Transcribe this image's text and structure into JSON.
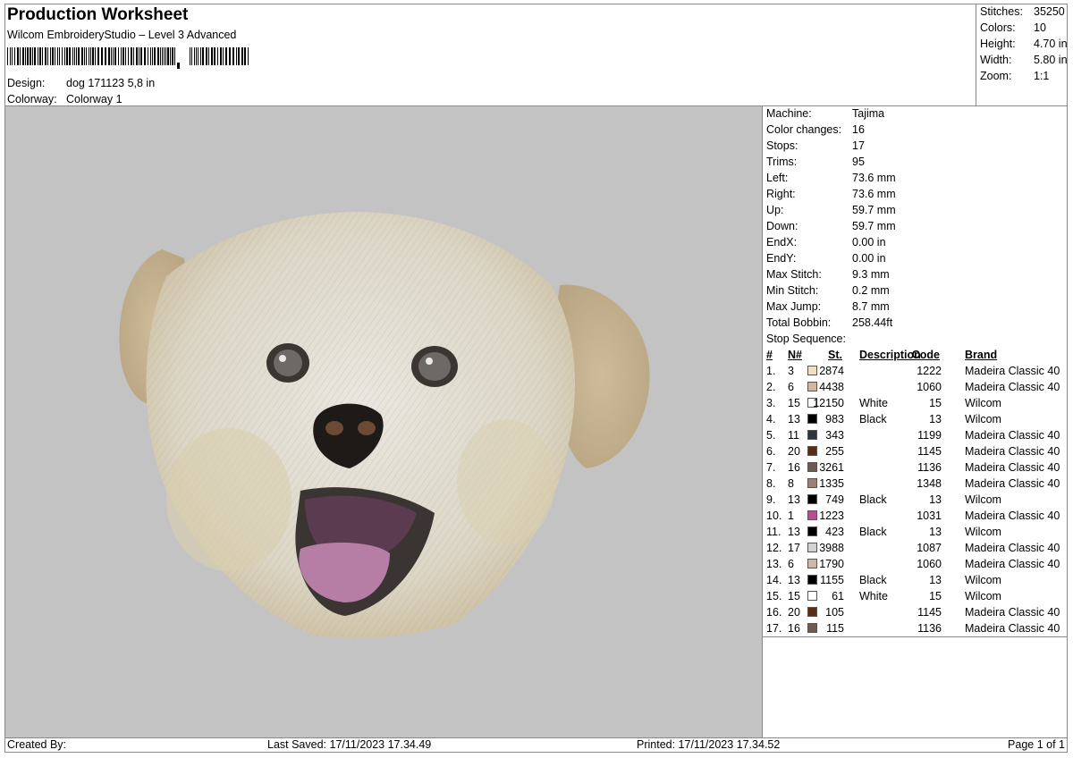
{
  "header": {
    "title": "Production Worksheet",
    "subtitle": "Wilcom EmbroideryStudio – Level 3 Advanced",
    "design_label": "Design:",
    "design_value": "dog 171123 5,8 in",
    "colorway_label": "Colorway:",
    "colorway_value": "Colorway 1"
  },
  "summary": [
    {
      "label": "Stitches:",
      "value": "35250"
    },
    {
      "label": "Colors:",
      "value": "10"
    },
    {
      "label": "Height:",
      "value": "4.70 in"
    },
    {
      "label": "Width:",
      "value": "5.80 in"
    },
    {
      "label": "Zoom:",
      "value": "1:1"
    }
  ],
  "machine_info": [
    {
      "label": "Machine:",
      "value": "Tajima"
    },
    {
      "label": "Color changes:",
      "value": "16"
    },
    {
      "label": "Stops:",
      "value": "17"
    },
    {
      "label": "Trims:",
      "value": "95"
    },
    {
      "label": "Left:",
      "value": "73.6 mm"
    },
    {
      "label": "Right:",
      "value": "73.6 mm"
    },
    {
      "label": "Up:",
      "value": "59.7 mm"
    },
    {
      "label": "Down:",
      "value": "59.7 mm"
    },
    {
      "label": "EndX:",
      "value": "0.00 in"
    },
    {
      "label": "EndY:",
      "value": "0.00 in"
    },
    {
      "label": "Max Stitch:",
      "value": "9.3 mm"
    },
    {
      "label": "Min Stitch:",
      "value": "0.2 mm"
    },
    {
      "label": "Max Jump:",
      "value": "8.7 mm"
    },
    {
      "label": "Total Bobbin:",
      "value": "258.44ft"
    }
  ],
  "stop_sequence": {
    "title": "Stop Sequence:",
    "headers": {
      "num": "#",
      "n": "N#",
      "st": "St.",
      "desc": "Description",
      "code": "Code",
      "brand": "Brand"
    },
    "rows": [
      {
        "num": "1.",
        "n": "3",
        "color": "#efe0c4",
        "st": "2874",
        "desc": "",
        "code": "1222",
        "brand": "Madeira Classic 40"
      },
      {
        "num": "2.",
        "n": "6",
        "color": "#cdb8a6",
        "st": "4438",
        "desc": "",
        "code": "1060",
        "brand": "Madeira Classic 40"
      },
      {
        "num": "3.",
        "n": "15",
        "color": "#ffffff",
        "st": "12150",
        "desc": "White",
        "code": "15",
        "brand": "Wilcom"
      },
      {
        "num": "4.",
        "n": "13",
        "color": "#000000",
        "st": "983",
        "desc": "Black",
        "code": "13",
        "brand": "Wilcom"
      },
      {
        "num": "5.",
        "n": "11",
        "color": "#2e3440",
        "st": "343",
        "desc": "",
        "code": "1199",
        "brand": "Madeira Classic 40"
      },
      {
        "num": "6.",
        "n": "20",
        "color": "#5a2e14",
        "st": "255",
        "desc": "",
        "code": "1145",
        "brand": "Madeira Classic 40"
      },
      {
        "num": "7.",
        "n": "16",
        "color": "#6e5a52",
        "st": "3261",
        "desc": "",
        "code": "1136",
        "brand": "Madeira Classic 40"
      },
      {
        "num": "8.",
        "n": "8",
        "color": "#9d7f74",
        "st": "1335",
        "desc": "",
        "code": "1348",
        "brand": "Madeira Classic 40"
      },
      {
        "num": "9.",
        "n": "13",
        "color": "#000000",
        "st": "749",
        "desc": "Black",
        "code": "13",
        "brand": "Wilcom"
      },
      {
        "num": "10.",
        "n": "1",
        "color": "#b3508f",
        "st": "1223",
        "desc": "",
        "code": "1031",
        "brand": "Madeira Classic 40"
      },
      {
        "num": "11.",
        "n": "13",
        "color": "#000000",
        "st": "423",
        "desc": "Black",
        "code": "13",
        "brand": "Wilcom"
      },
      {
        "num": "12.",
        "n": "17",
        "color": "#d4d2d0",
        "st": "3988",
        "desc": "",
        "code": "1087",
        "brand": "Madeira Classic 40"
      },
      {
        "num": "13.",
        "n": "6",
        "color": "#cdb8a6",
        "st": "1790",
        "desc": "",
        "code": "1060",
        "brand": "Madeira Classic 40"
      },
      {
        "num": "14.",
        "n": "13",
        "color": "#000000",
        "st": "1155",
        "desc": "Black",
        "code": "13",
        "brand": "Wilcom"
      },
      {
        "num": "15.",
        "n": "15",
        "color": "#ffffff",
        "st": "61",
        "desc": "White",
        "code": "15",
        "brand": "Wilcom"
      },
      {
        "num": "16.",
        "n": "20",
        "color": "#5a2e14",
        "st": "105",
        "desc": "",
        "code": "1145",
        "brand": "Madeira Classic 40"
      },
      {
        "num": "17.",
        "n": "16",
        "color": "#6e5a52",
        "st": "115",
        "desc": "",
        "code": "1136",
        "brand": "Madeira Classic 40"
      }
    ]
  },
  "footer": {
    "created_by": "Created By:",
    "last_saved": "Last Saved: 17/11/2023 17.34.49",
    "printed": "Printed: 17/11/2023 17.34.52",
    "page": "Page 1 of 1"
  },
  "design_image": {
    "icon": "dog-face-embroidery-icon",
    "background_color": "#c3c3c3"
  }
}
